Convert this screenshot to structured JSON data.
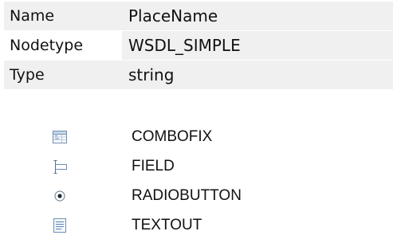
{
  "properties": [
    {
      "key": "Name",
      "value": "PlaceName"
    },
    {
      "key": "Nodetype",
      "value": "WSDL_SIMPLE"
    },
    {
      "key": "Type",
      "value": "string"
    }
  ],
  "control_types": [
    {
      "label": "COMBOFIX",
      "icon": "combobox-icon"
    },
    {
      "label": "FIELD",
      "icon": "text-field-icon"
    },
    {
      "label": "RADIOBUTTON",
      "icon": "radio-button-icon"
    },
    {
      "label": "TEXTOUT",
      "icon": "text-output-icon"
    }
  ],
  "colors": {
    "row_background": "#f0f0f0",
    "icon_blue": "#5a86b6",
    "text": "#111111"
  }
}
